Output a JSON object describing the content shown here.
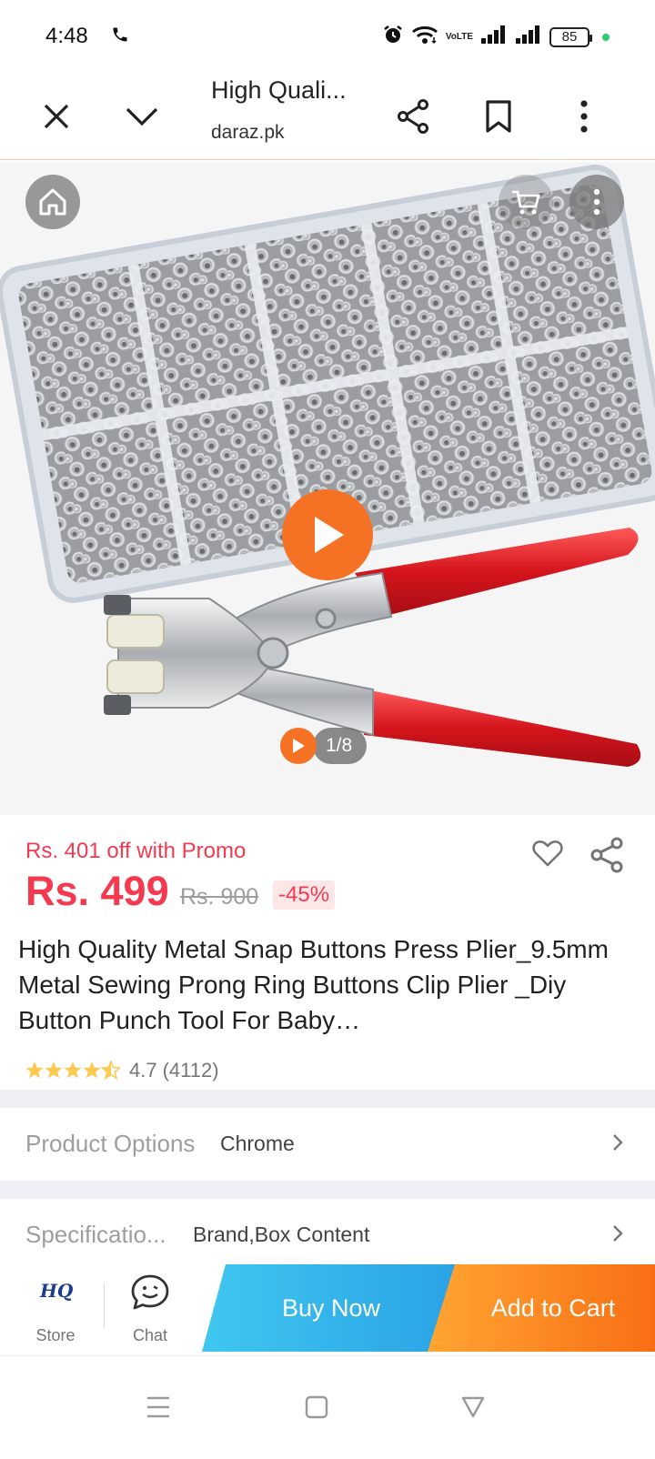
{
  "status": {
    "time": "4:48",
    "network_label": "VoLTE",
    "battery": "85"
  },
  "browser": {
    "title": "High Quali...",
    "domain": "daraz.pk"
  },
  "gallery": {
    "counter": "1/8"
  },
  "product": {
    "promo": "Rs. 401 off with Promo",
    "price": "Rs. 499",
    "original_price": "Rs. 900",
    "discount": "-45%",
    "title": "High Quality Metal Snap Buttons Press Plier_9.5mm Metal Sewing Prong Ring Buttons Clip Plier _Diy Button Punch Tool For Baby…",
    "rating": 4.7,
    "rating_text": "4.7",
    "reviews": "(4112)"
  },
  "options": {
    "label": "Product Options",
    "value": "Chrome"
  },
  "specs": {
    "label": "Specificatio...",
    "value": "Brand,Box Content"
  },
  "actions": {
    "store_label": "Store",
    "store_logo": "HQ",
    "chat_label": "Chat",
    "buy_now": "Buy Now",
    "add_to_cart": "Add to Cart"
  },
  "colors": {
    "accent": "#f57224",
    "price": "#f7394f",
    "buy_now": "#2aa2e6",
    "add_to_cart": "#f96e14",
    "star": "#faca51"
  },
  "icons": [
    "phone-icon",
    "alarm-icon",
    "wifi-icon",
    "signal-icon",
    "close-icon",
    "chevron-down-icon",
    "share-icon",
    "bookmark-icon",
    "more-icon",
    "home-icon",
    "cart-icon",
    "play-icon",
    "heart-icon",
    "chevron-right-icon",
    "chat-icon",
    "menu-icon",
    "square-icon",
    "back-triangle-icon"
  ]
}
